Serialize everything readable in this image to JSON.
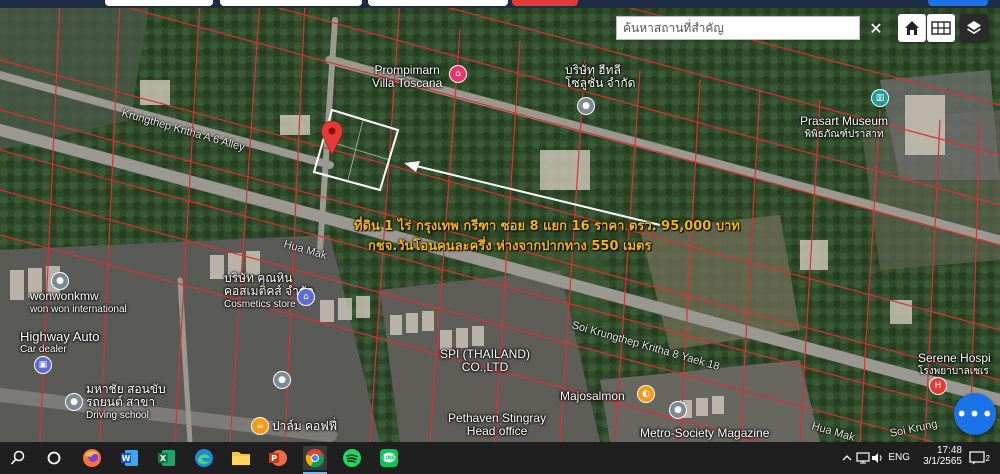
{
  "map": {
    "labels": {
      "prompimarn": [
        "Prompimarn",
        "Villa Toscana"
      ],
      "company_north": [
        "บริษัท ฮีทลี",
        "โซลูชั่น จำกัด"
      ],
      "prasart": [
        "Prasart Museum",
        "พิพิธภัณฑ์ปราสาท"
      ],
      "wonwonkmw": [
        "wonwonkmw",
        "won won international"
      ],
      "cosmetics": [
        "บริษัท คุณหิน",
        "คอสเมติคส์ จำกัด",
        "Cosmetics store"
      ],
      "highway_auto": [
        "Highway Auto",
        "Car dealer"
      ],
      "spi": [
        "SPI (THAILAND)",
        "CO.,LTD"
      ],
      "driving_school": [
        "มหาชัย สอนขับ",
        "รถยนต์ สาขา",
        "Driving school"
      ],
      "paam": [
        "ปาล์ม คอฟฟี่"
      ],
      "pethaven": [
        "Pethaven Stingray",
        "Head office"
      ],
      "majosalmon": [
        "Majosalmon"
      ],
      "metro_society": [
        "Metro-Society Magazine"
      ],
      "serene": [
        "Serene Hospi",
        "โรงพยาบาลเซเร"
      ]
    },
    "streets": {
      "krungthep_kritha_6": "Krungthep Kritha A 6 Alley",
      "hua_mak": "Hua Mak",
      "soi_krungthep_8": "Soi Krungthep Kritha 8 Yaek 18",
      "hua_mak_2": "Hua Mak",
      "soi_krung_2": "Soi Krung"
    },
    "annotation": {
      "line1": "ที่ดิน 1 ไร่ กรุงเทพ กรีฑา ซอย 8 แยก 16 ราคา ตรว. 95,000 บาท",
      "line2": "กชจ.วันโอนคนละครึ่ง ห่างจากปากทาง 550 เมตร",
      "color": "#f5b800"
    }
  },
  "search": {
    "placeholder": "ค้นหาสถานที่สำคัญ"
  },
  "controls": {
    "close_glyph": "✕",
    "fab_glyph": "•••"
  },
  "taskbar": {
    "time": "17:48",
    "date": "3/1/2565",
    "lang": "ENG",
    "notification_badge": "2"
  },
  "colors": {
    "parcel_line": "#d9322e",
    "pin": "#e53935",
    "fab": "#1a73e8",
    "header": "#1d2b45"
  }
}
